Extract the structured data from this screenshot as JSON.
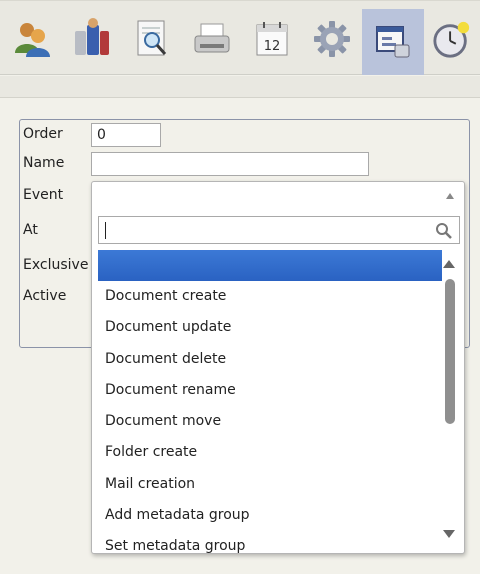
{
  "toolbar": {
    "buttons": [
      {
        "icon": "users-icon"
      },
      {
        "icon": "groups-icon"
      },
      {
        "icon": "search-document-icon"
      },
      {
        "icon": "scanner-icon"
      },
      {
        "icon": "calendar-icon",
        "day": "12"
      },
      {
        "icon": "settings-gear-icon"
      },
      {
        "icon": "automation-icon",
        "active": true
      },
      {
        "icon": "clock-icon"
      }
    ]
  },
  "form": {
    "order_label": "Order",
    "order_value": "0",
    "name_label": "Name",
    "name_value": "",
    "event_label": "Event",
    "at_label": "At",
    "exclusive_label": "Exclusive",
    "active_label": "Active"
  },
  "dropdown": {
    "search_value": "",
    "selected_index": 0,
    "options": [
      "",
      "Document create",
      "Document update",
      "Document delete",
      "Document rename",
      "Document move",
      "Folder create",
      "Mail creation",
      "Add metadata group",
      "Set metadata group"
    ]
  },
  "colors": {
    "selection": "#2f69c9",
    "active_tab": "#b9c3db",
    "panel_border": "#8b93a8"
  }
}
